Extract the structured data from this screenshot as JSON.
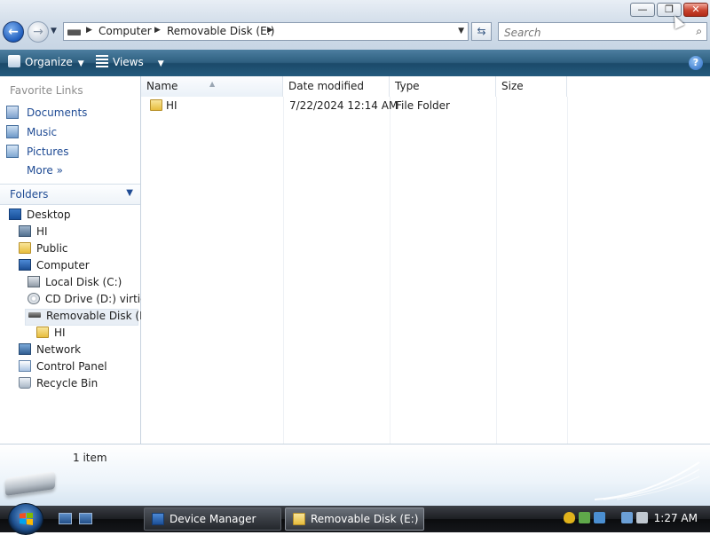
{
  "window": {
    "controls": {
      "minimize": "—",
      "maximize": "❐",
      "close": "✕"
    }
  },
  "address": {
    "segments": [
      "Computer",
      "Removable Disk (E:)"
    ],
    "search_placeholder": "Search"
  },
  "toolbar": {
    "organize": "Organize",
    "views": "Views",
    "help": "?"
  },
  "favorites": {
    "title": "Favorite Links",
    "items": [
      "Documents",
      "Music",
      "Pictures",
      "More"
    ]
  },
  "folders": {
    "title": "Folders",
    "tree": [
      "Desktop",
      "HI",
      "Public",
      "Computer",
      "Local Disk (C:)",
      "CD Drive (D:) virtio-",
      "Removable Disk (E:)",
      "HI",
      "Network",
      "Control Panel",
      "Recycle Bin"
    ]
  },
  "filelist": {
    "columns": [
      "Name",
      "Date modified",
      "Type",
      "Size"
    ],
    "rows": [
      {
        "name": "HI",
        "date": "7/22/2024 12:14 AM",
        "type": "File Folder",
        "size": ""
      }
    ]
  },
  "details": {
    "count": "1 item"
  },
  "taskbar": {
    "tasks": [
      "Device Manager",
      "Removable Disk (E:)"
    ],
    "clock": "1:27 AM"
  },
  "colors": {
    "accent": "#1f4b94",
    "commandbar": "#2e5f80"
  }
}
